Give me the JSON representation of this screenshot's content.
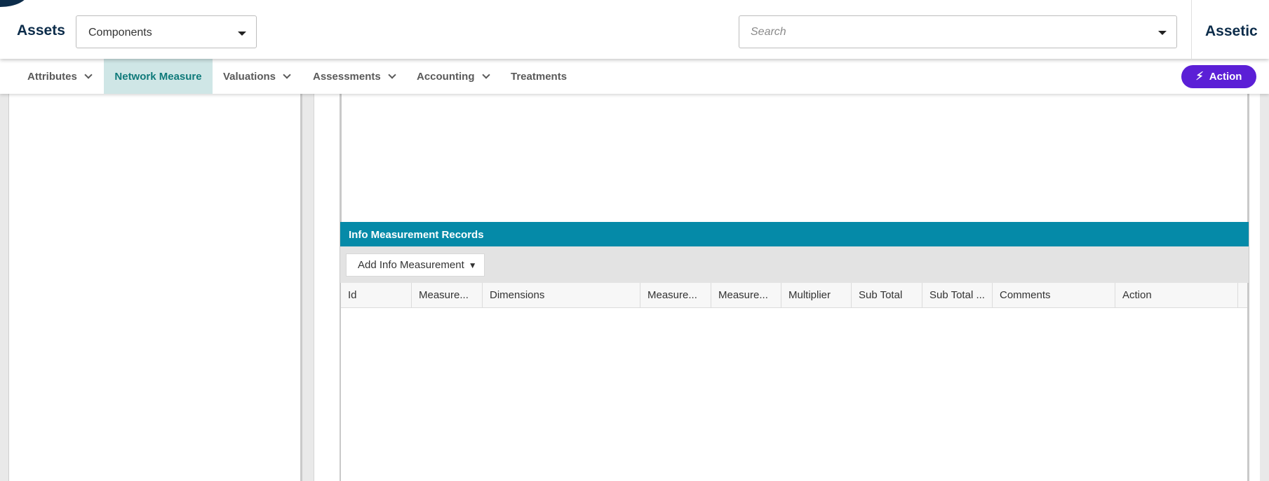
{
  "header": {
    "app_title": "Assets",
    "module_select": {
      "value": "Components"
    },
    "search": {
      "placeholder": "Search"
    },
    "brand": "Assetic"
  },
  "nav": {
    "items": [
      {
        "label": "Attributes",
        "has_dropdown": true
      },
      {
        "label": "Network Measure",
        "has_dropdown": false,
        "active": true
      },
      {
        "label": "Valuations",
        "has_dropdown": true
      },
      {
        "label": "Assessments",
        "has_dropdown": true
      },
      {
        "label": "Accounting",
        "has_dropdown": true
      },
      {
        "label": "Treatments",
        "has_dropdown": false
      }
    ],
    "action_button": {
      "label": "Action",
      "icon": "lightning-bolt-icon"
    }
  },
  "section": {
    "title": "Info Measurement Records",
    "add_button": "Add Info Measurement",
    "columns": [
      "Id",
      "Measure...",
      "Dimensions",
      "Measure...",
      "Measure...",
      "Multiplier",
      "Sub Total",
      "Sub Total ...",
      "Comments",
      "Action"
    ],
    "rows": []
  },
  "colors": {
    "brand": "#0c2c4a",
    "accent_teal": "#058aa8",
    "active_tab_bg": "#cfe6e6",
    "active_tab_text": "#0f7a7a",
    "action_button": "#5b1fd6"
  }
}
